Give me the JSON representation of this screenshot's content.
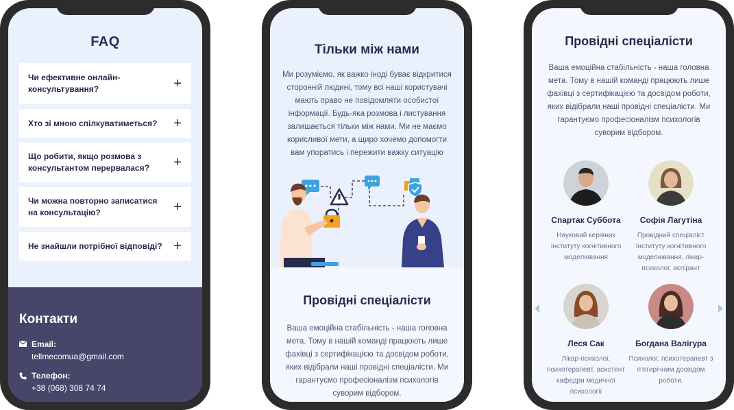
{
  "phone1": {
    "faq_title": "FAQ",
    "faq_items": [
      {
        "question": "Чи ефективне онлайн-консультування?"
      },
      {
        "question": "Хто зі мною спілкуватиметься?"
      },
      {
        "question": "Що робити, якщо розмова з консультантом перервалася?"
      },
      {
        "question": "Чи можна повторно записатися на консультацію?"
      },
      {
        "question": "Не знайшли потрібної відповіді?"
      }
    ],
    "contacts_title": "Контакти",
    "email_label": "Email:",
    "email_value": "tellmecomua@gmail.com",
    "phone_label": "Телефон:",
    "phone_value": "+38 (068) 308 74 74"
  },
  "phone2": {
    "title": "Тільки між нами",
    "text": "Ми розуміємо, як важко іноді буває відкритися сторонній людині, тому всі наші користувачі мають право не повідомляти особистої інформації. Будь-яка розмова і листування залишається тільки між нами. Ми не маємо корисливої мети, а щиро хочемо допомогти вам упоратись і пережити важку ситуацію",
    "title2": "Провідні спеціалісти",
    "text2": "Ваша емоційна стабільність - наша головна мета. Тому в нашій команді працюють лише фахівці з сертифікацією та досвідом роботи, яких відібрали наші провідні спеціалісти. Ми гарантуємо професіоналізм психологів суворим відбором."
  },
  "phone3": {
    "title": "Провідні спеціалісти",
    "text": "Ваша емоційна стабільність - наша головна мета. Тому в нашій команді працюють лише фахівці з сертифікацією та досвідом роботи, яких відібрали наші провідні спеціалісти. Ми гарантуємо професіоналізм психологів суворим відбором.",
    "specialists": [
      {
        "name": "Спартак Суббота",
        "role": "Науковий керівник Інституту когнітивного моделювання"
      },
      {
        "name": "Софія Лагутіна",
        "role": "Провідний спеціаліст Інституту когнітивного моделювання, лікар-психолог, аспірант"
      },
      {
        "name": "Леся Сак",
        "role": "Лікар-психолог, психотерапевт, асистент кафедри медичної психології"
      },
      {
        "name": "Богдана Валігура",
        "role": "Психолог, психотерапевт з п'ятирічним досвідом роботи."
      }
    ]
  },
  "colors": {
    "navy": "#262a4f",
    "contacts_bg": "#47456a",
    "screen_bg": "#eaf1fd",
    "accent_blue": "#3ea1e0",
    "accent_orange": "#f4a020"
  }
}
